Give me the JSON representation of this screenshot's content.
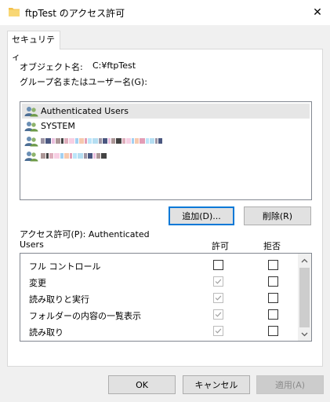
{
  "window": {
    "title": "ftpTest のアクセス許可",
    "close_glyph": "✕"
  },
  "tab": {
    "label": "セキュリティ"
  },
  "object": {
    "label": "オブジェクト名:",
    "value": "C:¥ftpTest"
  },
  "group_label": "グループ名またはユーザー名(G):",
  "users": [
    {
      "name": "Authenticated Users",
      "icon": "users-icon",
      "selected": true
    },
    {
      "name": "SYSTEM",
      "icon": "users-icon"
    },
    {
      "name": "",
      "icon": "users-icon",
      "redacted": true
    },
    {
      "name": "",
      "icon": "users-icon",
      "redacted": true
    }
  ],
  "buttons": {
    "add": "追加(D)...",
    "remove": "削除(R)",
    "ok": "OK",
    "cancel": "キャンセル",
    "apply": "適用(A)"
  },
  "permissions": {
    "label_line1": "アクセス許可(P): Authenticated",
    "label_line2": "Users",
    "allow_header": "許可",
    "deny_header": "拒否",
    "rows": [
      {
        "name": "フル コントロール",
        "allow": false,
        "allow_inherited": false,
        "deny": false
      },
      {
        "name": "変更",
        "allow": true,
        "allow_inherited": true,
        "deny": false
      },
      {
        "name": "読み取りと実行",
        "allow": true,
        "allow_inherited": true,
        "deny": false
      },
      {
        "name": "フォルダーの内容の一覧表示",
        "allow": true,
        "allow_inherited": true,
        "deny": false
      },
      {
        "name": "読み取り",
        "allow": true,
        "allow_inherited": true,
        "deny": false
      }
    ]
  },
  "colors": {
    "accent": "#0078d7",
    "folder": "#f3c04a"
  }
}
